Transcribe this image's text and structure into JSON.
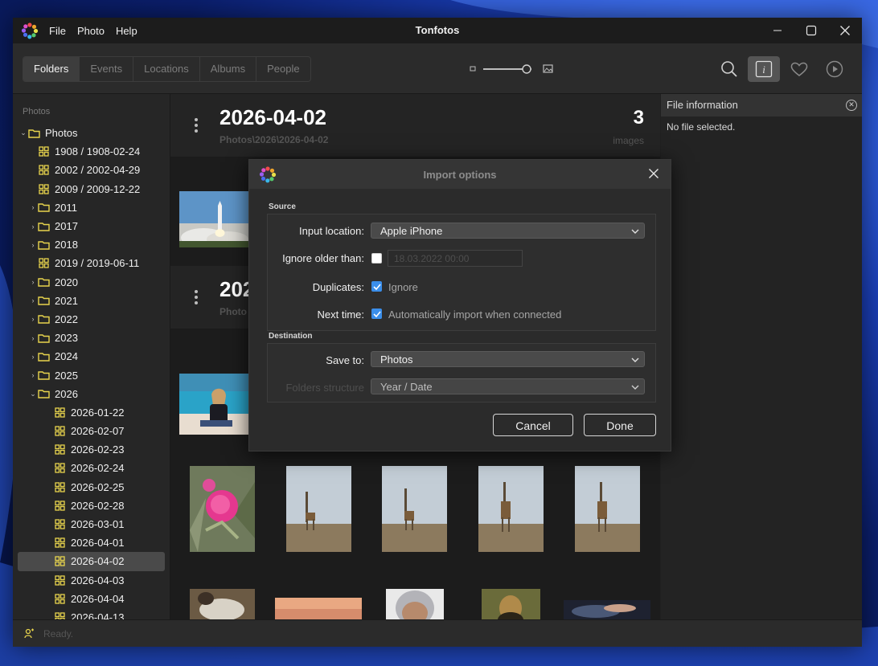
{
  "app": {
    "title": "Tonfotos",
    "menu": [
      "File",
      "Photo",
      "Help"
    ]
  },
  "toolbar": {
    "tabs": [
      {
        "label": "Folders",
        "active": true
      },
      {
        "label": "Events",
        "active": false
      },
      {
        "label": "Locations",
        "active": false
      },
      {
        "label": "Albums",
        "active": false
      },
      {
        "label": "People",
        "active": false
      }
    ],
    "zoom_level": 0.9,
    "icons": [
      "search-icon",
      "info-icon",
      "heart-icon",
      "play-icon"
    ],
    "active_icon": "info-icon"
  },
  "sidebar": {
    "header": "Photos",
    "root": "Photos",
    "items": [
      {
        "label": "1908 / 1908-02-24",
        "kind": "event",
        "level": 1
      },
      {
        "label": "2002 / 2002-04-29",
        "kind": "event",
        "level": 1
      },
      {
        "label": "2009 / 2009-12-22",
        "kind": "event",
        "level": 1
      },
      {
        "label": "2011",
        "kind": "folder",
        "level": 1
      },
      {
        "label": "2017",
        "kind": "folder",
        "level": 1
      },
      {
        "label": "2018",
        "kind": "folder",
        "level": 1
      },
      {
        "label": "2019 / 2019-06-11",
        "kind": "event",
        "level": 1
      },
      {
        "label": "2020",
        "kind": "folder",
        "level": 1
      },
      {
        "label": "2021",
        "kind": "folder",
        "level": 1
      },
      {
        "label": "2022",
        "kind": "folder",
        "level": 1
      },
      {
        "label": "2023",
        "kind": "folder",
        "level": 1
      },
      {
        "label": "2024",
        "kind": "folder",
        "level": 1
      },
      {
        "label": "2025",
        "kind": "folder",
        "level": 1
      },
      {
        "label": "2026",
        "kind": "folder-open",
        "level": 1
      },
      {
        "label": "2026-01-22",
        "kind": "event",
        "level": 2
      },
      {
        "label": "2026-02-07",
        "kind": "event",
        "level": 2
      },
      {
        "label": "2026-02-23",
        "kind": "event",
        "level": 2
      },
      {
        "label": "2026-02-24",
        "kind": "event",
        "level": 2
      },
      {
        "label": "2026-02-25",
        "kind": "event",
        "level": 2
      },
      {
        "label": "2026-02-28",
        "kind": "event",
        "level": 2
      },
      {
        "label": "2026-03-01",
        "kind": "event",
        "level": 2
      },
      {
        "label": "2026-04-01",
        "kind": "event",
        "level": 2
      },
      {
        "label": "2026-04-02",
        "kind": "event",
        "level": 2,
        "selected": true
      },
      {
        "label": "2026-04-03",
        "kind": "event",
        "level": 2
      },
      {
        "label": "2026-04-04",
        "kind": "event",
        "level": 2
      },
      {
        "label": "2026-04-13",
        "kind": "event",
        "level": 2
      }
    ]
  },
  "content": {
    "groups": [
      {
        "date": "2026-04-02",
        "path": "Photos\\2026\\2026-04-02",
        "count": "3",
        "unit": "images"
      },
      {
        "date": "202",
        "path": "Photo"
      }
    ]
  },
  "info_panel": {
    "title": "File information",
    "empty_text": "No file selected."
  },
  "status": {
    "text": "Ready."
  },
  "dialog": {
    "title": "Import options",
    "source_label": "Source",
    "input_location_label": "Input location:",
    "input_location_value": "Apple iPhone",
    "ignore_older_label": "Ignore older than:",
    "ignore_older_checked": false,
    "ignore_older_date": "18.03.2022 00:00",
    "duplicates_label": "Duplicates:",
    "duplicates_option": "Ignore",
    "duplicates_checked": true,
    "next_time_label": "Next time:",
    "next_time_option": "Automatically import when connected",
    "next_time_checked": true,
    "destination_label": "Destination",
    "save_to_label": "Save to:",
    "save_to_value": "Photos",
    "folders_structure_label": "Folders structure",
    "folders_structure_value": "Year / Date",
    "cancel_label": "Cancel",
    "done_label": "Done"
  },
  "colors": {
    "accent": "#3b8eea",
    "folder_icon": "#e8d44d",
    "window_bg": "#202020"
  }
}
